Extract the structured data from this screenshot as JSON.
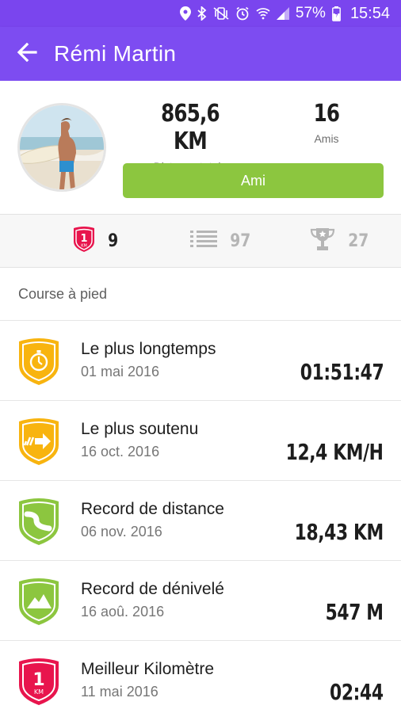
{
  "status_bar": {
    "battery": "57%",
    "time": "15:54",
    "icons": [
      "location-icon",
      "bluetooth-icon",
      "vibrate-mute-icon",
      "alarm-icon",
      "wifi-icon",
      "signal-icon",
      "battery-icon"
    ]
  },
  "app_bar": {
    "title": "Rémi Martin",
    "back_icon": "arrow-left-icon"
  },
  "profile": {
    "distance_value": "865,6 KM",
    "distance_label": "Distance totale",
    "friends_value": "16",
    "friends_label": "Amis",
    "friend_button": "Ami"
  },
  "tabs": [
    {
      "icon": "km-badge-icon",
      "count": "9",
      "active": true
    },
    {
      "icon": "list-icon",
      "count": "97",
      "active": false
    },
    {
      "icon": "trophy-icon",
      "count": "27",
      "active": false
    }
  ],
  "section": {
    "title": "Course à pied"
  },
  "records": [
    {
      "title": "Le plus longtemps",
      "date": "01 mai 2016",
      "value": "01:51:47",
      "icon": "stopwatch-icon",
      "color": "#f8b40f"
    },
    {
      "title": "Le plus soutenu",
      "date": "16 oct. 2016",
      "value": "12,4 KM/H",
      "icon": "speed-arrow-icon",
      "color": "#f8b40f"
    },
    {
      "title": "Record de distance",
      "date": "06 nov. 2016",
      "value": "18,43 KM",
      "icon": "road-icon",
      "color": "#8cc63f"
    },
    {
      "title": "Record de dénivelé",
      "date": "16 aoû. 2016",
      "value": "547 M",
      "icon": "mountain-icon",
      "color": "#8cc63f"
    },
    {
      "title": "Meilleur Kilomètre",
      "date": "11 mai 2016",
      "value": "02:44",
      "icon": "km-badge-icon",
      "color": "#e8154d",
      "badge_text": "1",
      "badge_sub": "KM"
    }
  ],
  "colors": {
    "primary": "#7d4cf1",
    "accent_green": "#8cc63f",
    "accent_yellow": "#f8b40f",
    "accent_red": "#e8154d"
  }
}
